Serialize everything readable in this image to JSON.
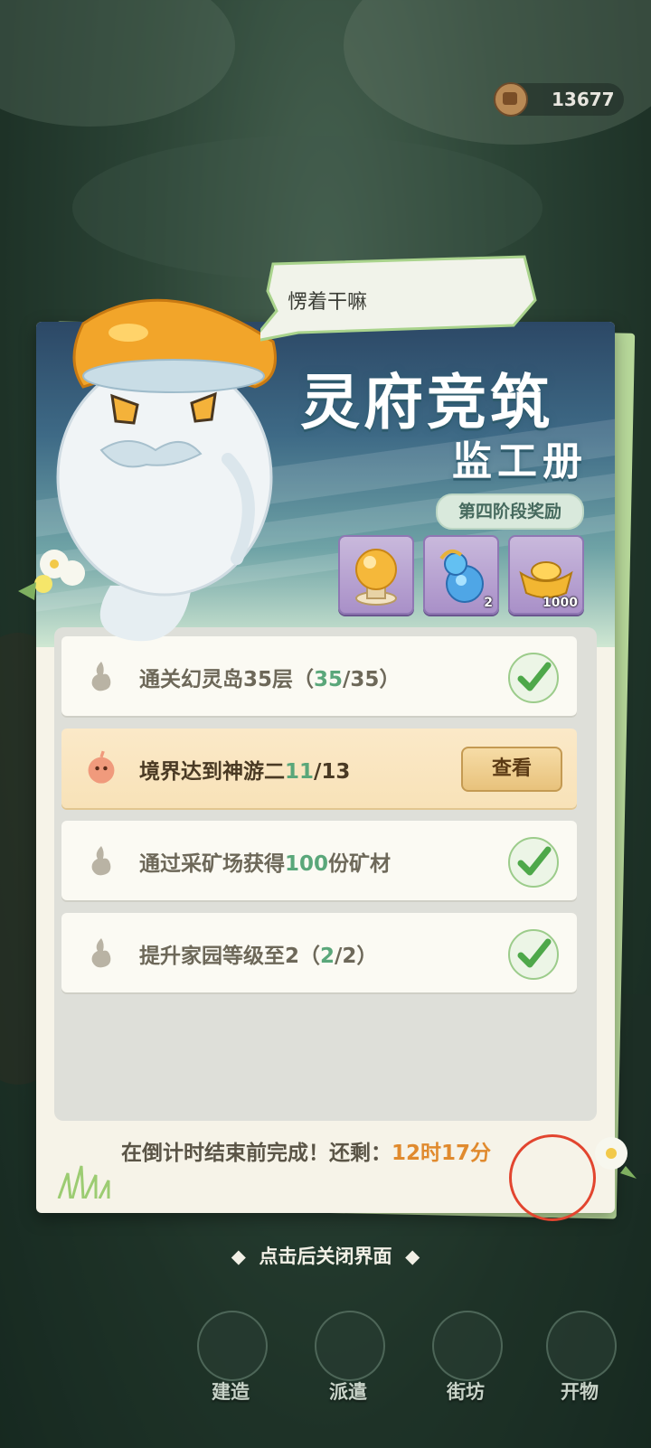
{
  "top_bar": {
    "coin_value": "13677"
  },
  "speech_bubble": {
    "text": "愣着干嘛"
  },
  "card": {
    "title_line1": "灵府竞筑",
    "title_line2": "监工册",
    "stage_label": "第四阶段奖励",
    "rewards": [
      {
        "icon": "golden-orb-icon",
        "count": ""
      },
      {
        "icon": "blue-gourd-icon",
        "count": "2"
      },
      {
        "icon": "gold-ingot-icon",
        "count": "1000"
      }
    ],
    "tasks": [
      {
        "prefix": "通关幻灵岛35层（",
        "progress": "35",
        "suffix": "/35）",
        "status": "done"
      },
      {
        "prefix": "境界达到神游二",
        "progress": "11",
        "suffix": "/13",
        "status": "in_progress",
        "button_label": "查看"
      },
      {
        "prefix": "通过采矿场获得",
        "progress": "100",
        "suffix": "份矿材",
        "status": "done"
      },
      {
        "prefix": "提升家园等级至2（",
        "progress": "2",
        "suffix": "/2）",
        "status": "done"
      }
    ],
    "countdown_label": "在倒计时结束前完成！还剩：",
    "countdown_time": "12时17分"
  },
  "close_hint": "点击后关闭界面",
  "bottom_nav": [
    {
      "label": "建造"
    },
    {
      "label": "派遣"
    },
    {
      "label": "街坊"
    },
    {
      "label": "开物"
    }
  ],
  "colors": {
    "accent_green": "#5aa77a",
    "countdown_orange": "#e08a2e",
    "highlight_circle": "#e2452f"
  }
}
